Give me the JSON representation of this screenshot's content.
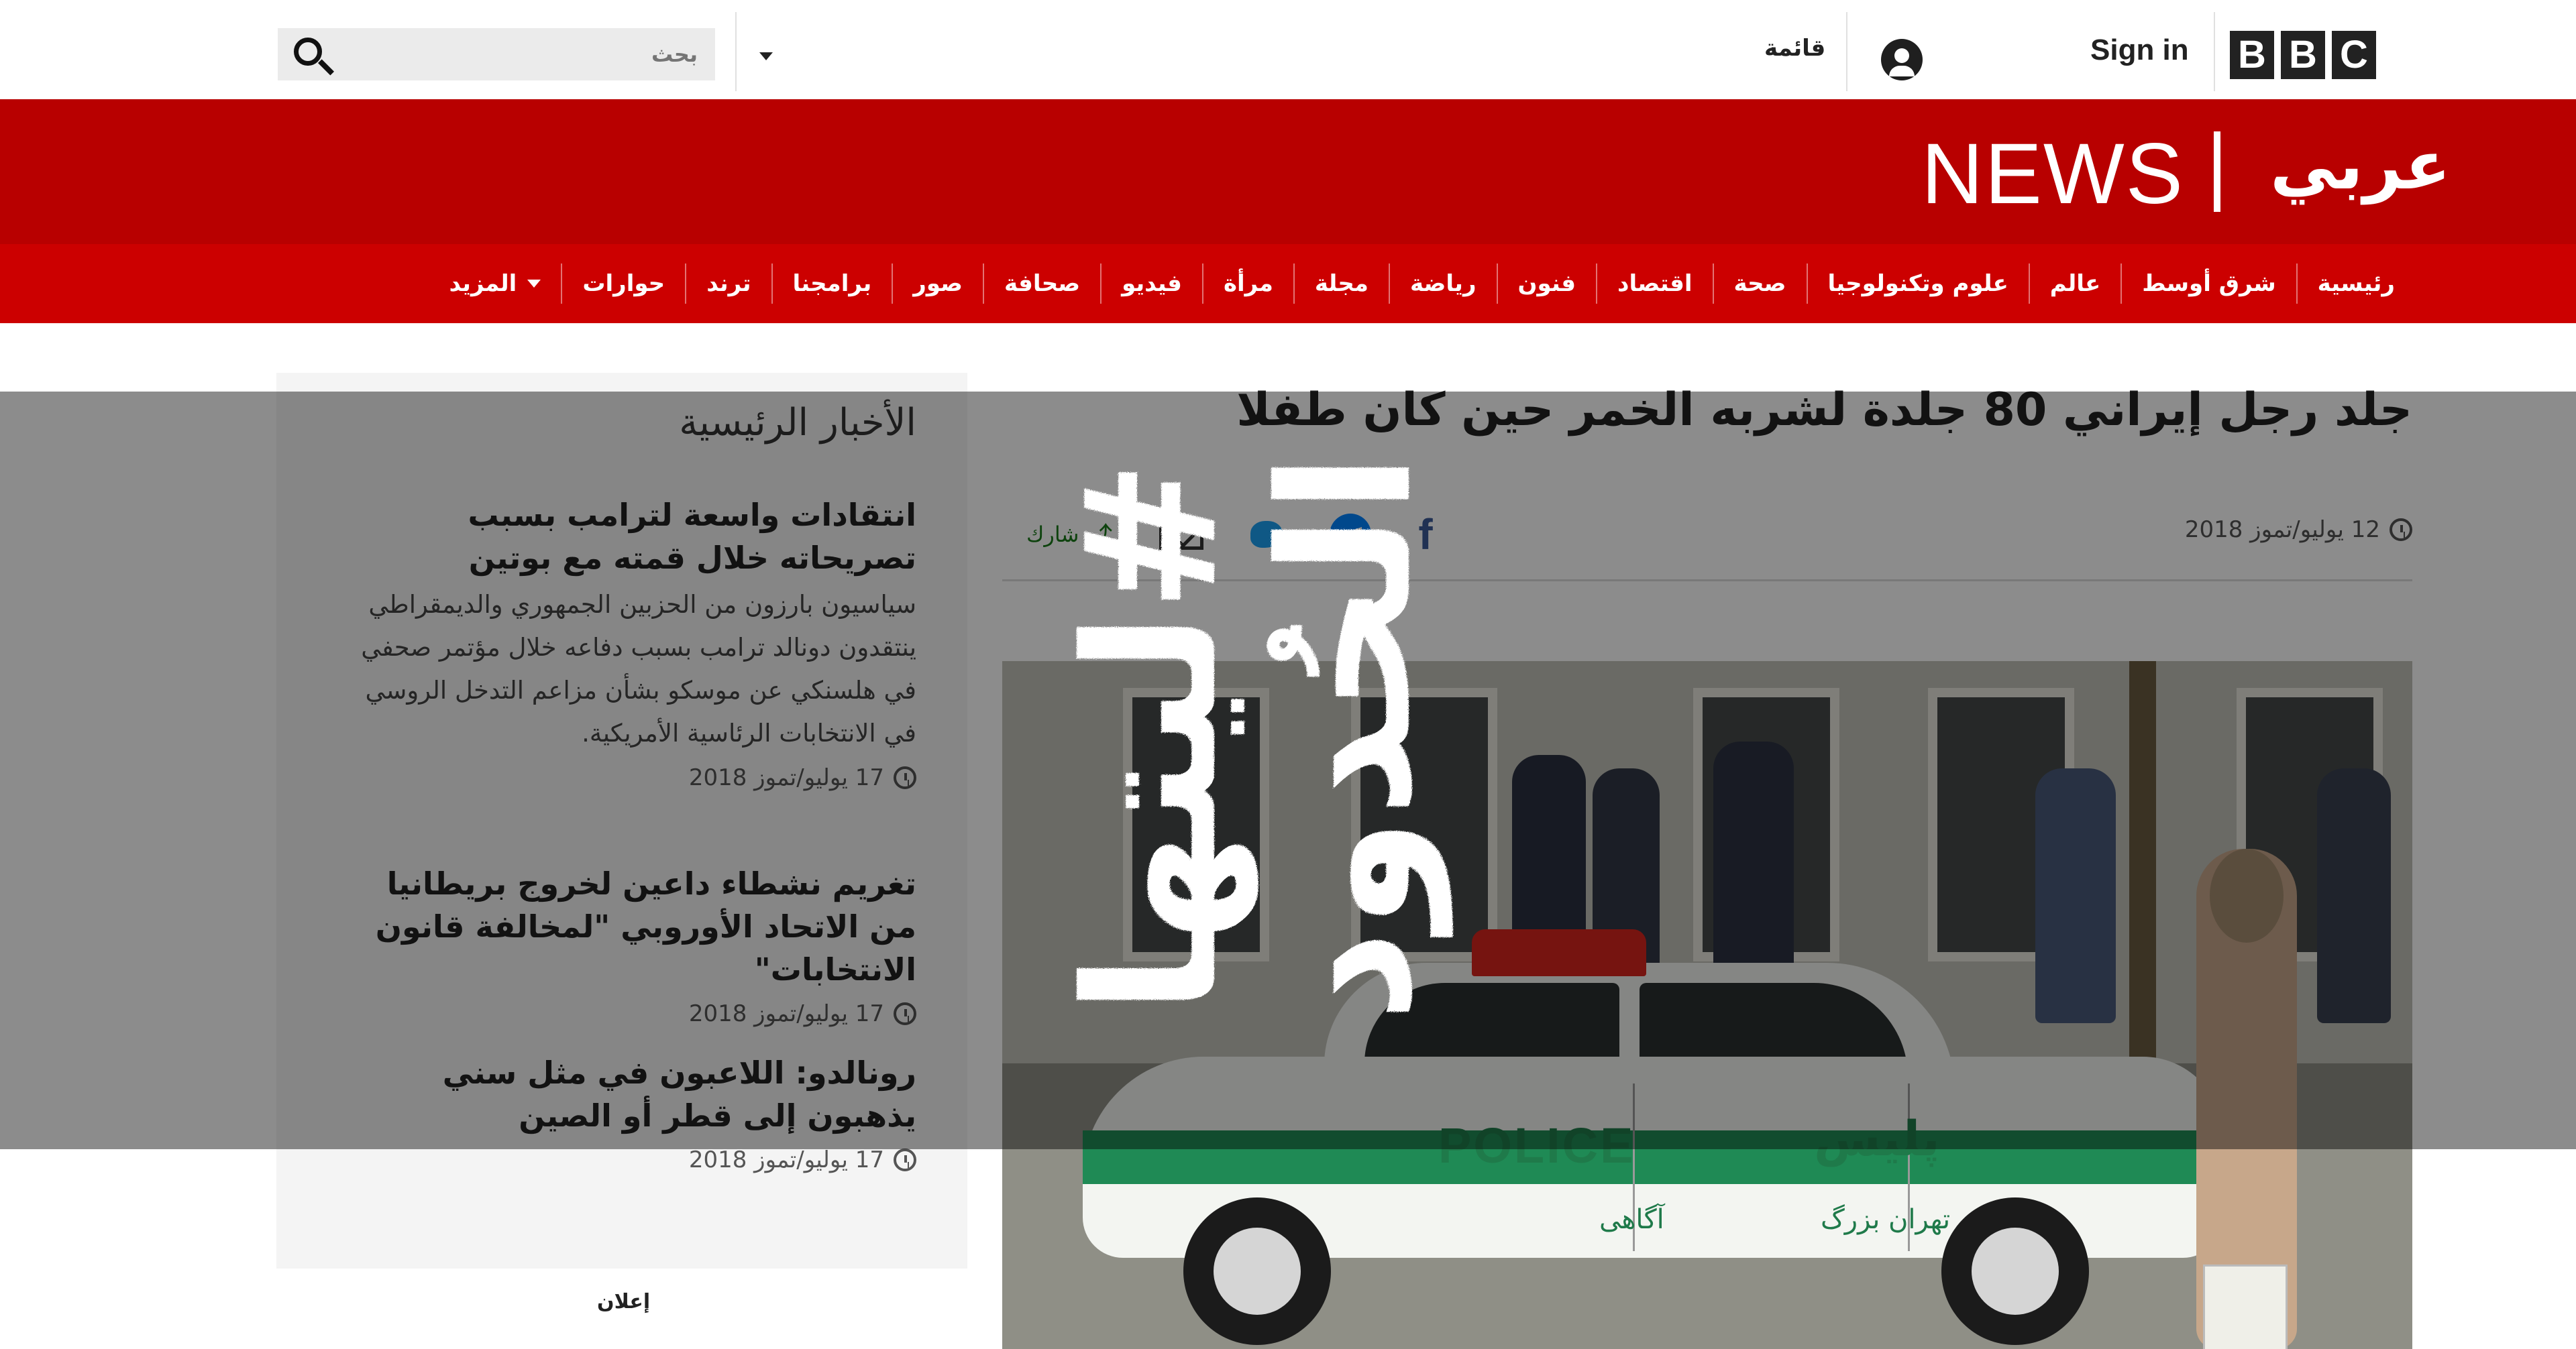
{
  "topbar": {
    "brand_letters": [
      "B",
      "B",
      "C"
    ],
    "sign_in": "Sign in",
    "menu_label": "قائمة",
    "search_placeholder": "بحث",
    "icons": [
      "account-icon",
      "chevron-down-icon",
      "search-icon"
    ]
  },
  "masthead": {
    "news_word": "NEWS",
    "arabic_brand": "عربي",
    "color": "#b80000"
  },
  "nav": {
    "items": [
      "رئيسية",
      "شرق أوسط",
      "عالم",
      "علوم وتكنولوجيا",
      "صحة",
      "اقتصاد",
      "فنون",
      "رياضة",
      "مجلة",
      "مرأة",
      "فيديو",
      "صحافة",
      "صور",
      "برامجنا",
      "ترند",
      "حوارات"
    ],
    "more_label": "المزيد",
    "color": "#cc0000"
  },
  "article": {
    "headline": "جلد رجل إيراني 80 جلدة لشربه الخمر حين كان طفلا",
    "date": "12 يوليو/تموز 2018",
    "share_label": "شارك",
    "share_icons": [
      "facebook-icon",
      "messenger-icon",
      "twitter-icon",
      "email-icon",
      "share-icon"
    ],
    "photo": {
      "police_text": "POLICE",
      "police_farsi": "پلیس",
      "door_text_1": "آگاهی",
      "door_text_2": "تهران بزرگ"
    }
  },
  "sidebar": {
    "title": "الأخبار الرئيسية",
    "items": [
      {
        "headline": "انتقادات واسعة لترامب بسبب تصريحاته خلال قمته مع بوتين",
        "summary": "سياسيون بارزون من الحزبين الجمهوري والديمقراطي ينتقدون دونالد ترامب بسبب دفاعه خلال مؤتمر صحفي في هلسنكي عن موسكو بشأن مزاعم التدخل الروسي في الانتخابات الرئاسية الأمريكية.",
        "date": "17 يوليو/تموز 2018"
      },
      {
        "headline": "تغريم نشطاء داعين لخروج بريطانيا من الاتحاد الأوروبي \"لمخالفة قانون الانتخابات\"",
        "date": "17 يوليو/تموز 2018"
      },
      {
        "headline": "رونالدو: اللاعبون في مثل سني يذهبون إلى قطر أو الصين",
        "date": "17 يوليو/تموز 2018"
      }
    ],
    "ad_label": "إعلان"
  },
  "overlay_graphic": {
    "line1": "#ليتها",
    "line2": "الحُدود"
  }
}
